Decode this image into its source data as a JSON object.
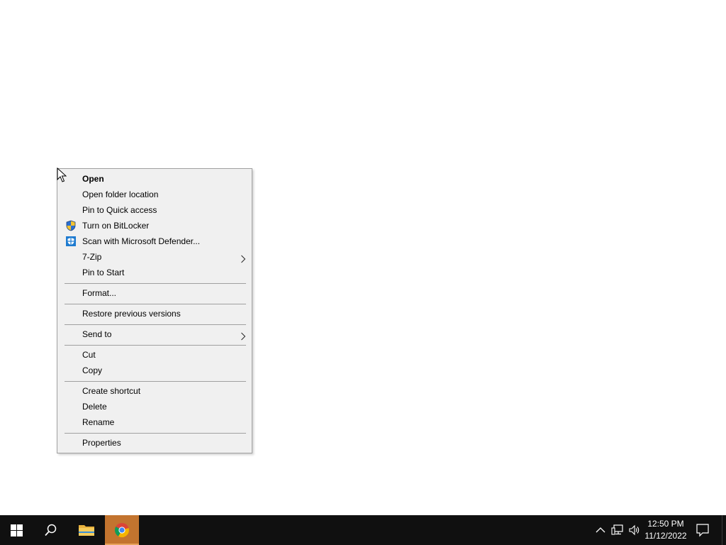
{
  "context_menu": {
    "items": [
      {
        "label": "Open",
        "bold": true
      },
      {
        "label": "Open folder location"
      },
      {
        "label": "Pin to Quick access"
      },
      {
        "label": "Turn on BitLocker",
        "icon": "shield-uac-icon"
      },
      {
        "label": "Scan with Microsoft Defender...",
        "icon": "defender-icon"
      },
      {
        "label": "7-Zip",
        "submenu": true
      },
      {
        "label": "Pin to Start"
      },
      {
        "label": "Format..."
      },
      {
        "label": "Restore previous versions"
      },
      {
        "label": "Send to",
        "submenu": true
      },
      {
        "label": "Cut"
      },
      {
        "label": "Copy"
      },
      {
        "label": "Create shortcut"
      },
      {
        "label": "Delete"
      },
      {
        "label": "Rename"
      },
      {
        "label": "Properties"
      }
    ]
  },
  "taskbar": {
    "apps": [
      {
        "name": "start",
        "icon": "windows-logo-icon"
      },
      {
        "name": "search",
        "icon": "search-icon"
      },
      {
        "name": "file-explorer",
        "icon": "folder-icon"
      },
      {
        "name": "chrome",
        "icon": "chrome-icon",
        "active": true
      }
    ],
    "tray": {
      "icons": [
        "chevron-up-icon",
        "network-icon",
        "volume-icon"
      ],
      "time": "12:50 PM",
      "date": "11/12/2022"
    }
  },
  "colors": {
    "taskbar_bg": "#101010",
    "active_app_bg": "#c3742f",
    "menu_bg": "#f0f0f0",
    "menu_border": "#a0a0a0"
  }
}
